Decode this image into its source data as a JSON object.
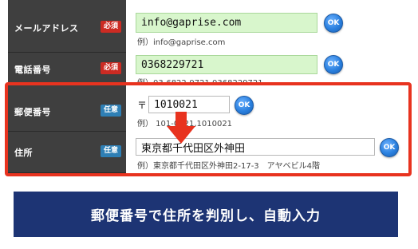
{
  "form": {
    "email": {
      "label": "メールアドレス",
      "badge": "必須",
      "value": "info@gaprise.com",
      "example": "例）info@gaprise.com",
      "ok": "OK"
    },
    "phone": {
      "label": "電話番号",
      "badge": "必須",
      "value": "0368229721",
      "example": "例）03-6822-9721,0368229721",
      "ok": "OK"
    },
    "postal": {
      "label": "郵便番号",
      "badge": "任意",
      "mark": "〒",
      "value": "1010021",
      "example": "例） 101-0021,1010021",
      "ok": "OK"
    },
    "address": {
      "label": "住所",
      "badge": "任意",
      "value": "東京都千代田区外神田",
      "example": "例）東京都千代田区外神田2-17-3　アヤベビル4階",
      "ok": "OK"
    }
  },
  "banner": {
    "text": "郵便番号で住所を判別し、自動入力"
  },
  "colors": {
    "highlight": "#e8331f",
    "banner_bg": "#1d3474",
    "required": "#cc2b23",
    "optional": "#2e7fb5",
    "filled_input": "#d8f6cc"
  },
  "icons": {
    "arrow": "down-arrow-icon",
    "ok": "ok-button-icon"
  }
}
